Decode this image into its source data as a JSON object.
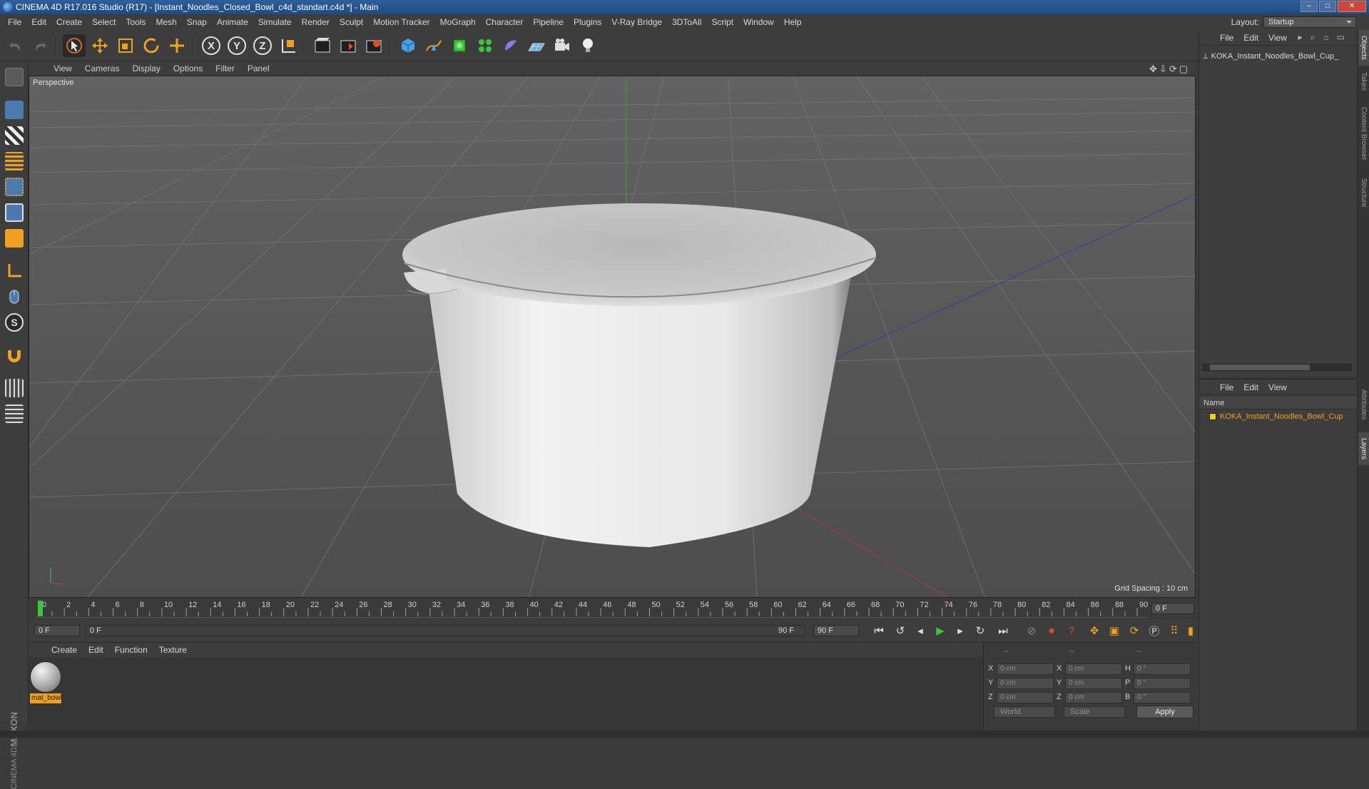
{
  "window": {
    "title": "CINEMA 4D R17.016 Studio (R17) - [Instant_Noodles_Closed_Bowl_c4d_standart.c4d *] - Main"
  },
  "menu": [
    "File",
    "Edit",
    "Create",
    "Select",
    "Tools",
    "Mesh",
    "Snap",
    "Animate",
    "Simulate",
    "Render",
    "Sculpt",
    "Motion Tracker",
    "MoGraph",
    "Character",
    "Pipeline",
    "Plugins",
    "V-Ray Bridge",
    "3DToAll",
    "Script",
    "Window",
    "Help"
  ],
  "layout": {
    "label": "Layout:",
    "value": "Startup"
  },
  "toolbar_icons": [
    "undo-icon",
    "redo-icon",
    "select-arrow-icon",
    "move-icon",
    "scale-icon",
    "rotate-icon",
    "transform-icon",
    "x-axis-icon",
    "y-axis-icon",
    "z-axis-icon",
    "coordinate-system-icon",
    "render-view-icon",
    "render-picture-viewer-icon",
    "render-settings-icon",
    "cube-primitive-icon",
    "pen-spline-icon",
    "subdivision-icon",
    "cloner-icon",
    "deformer-icon",
    "floor-icon",
    "camera-icon",
    "light-icon"
  ],
  "viewport": {
    "menu": [
      "View",
      "Cameras",
      "Display",
      "Options",
      "Filter",
      "Panel"
    ],
    "label": "Perspective",
    "grid_spacing": "Grid Spacing : 10 cm"
  },
  "timeline": {
    "ticks": [
      "0",
      "2",
      "4",
      "6",
      "8",
      "10",
      "12",
      "14",
      "16",
      "18",
      "20",
      "22",
      "24",
      "26",
      "28",
      "30",
      "32",
      "34",
      "36",
      "38",
      "40",
      "42",
      "44",
      "46",
      "48",
      "50",
      "52",
      "54",
      "56",
      "58",
      "60",
      "62",
      "64",
      "66",
      "68",
      "70",
      "72",
      "74",
      "76",
      "78",
      "80",
      "82",
      "84",
      "86",
      "88",
      "90"
    ],
    "current_frame": "0 F",
    "playhead_frame": 0
  },
  "transport": {
    "start": "0 F",
    "range_start": "0 F",
    "range_end": "90 F",
    "end": "90 F"
  },
  "material_panel": {
    "menu": [
      "Create",
      "Edit",
      "Function",
      "Texture"
    ],
    "material_name": "mat_bowl"
  },
  "coords": {
    "header": [
      "--",
      "--",
      "--"
    ],
    "rows": [
      {
        "a": "X",
        "av": "0 cm",
        "b": "X",
        "bv": "0 cm",
        "c": "H",
        "cv": "0 °"
      },
      {
        "a": "Y",
        "av": "0 cm",
        "b": "Y",
        "bv": "0 cm",
        "c": "P",
        "cv": "0 °"
      },
      {
        "a": "Z",
        "av": "0 cm",
        "b": "Z",
        "bv": "0 cm",
        "c": "B",
        "cv": "0 °"
      }
    ],
    "mode1": "World",
    "mode2": "Scale",
    "apply": "Apply"
  },
  "object_manager": {
    "menu": [
      "File",
      "Edit",
      "View"
    ],
    "object": "KOKA_Instant_Noodles_Bowl_Cup_"
  },
  "layer_manager": {
    "menu": [
      "File",
      "Edit",
      "View"
    ],
    "column": "Name",
    "layer": "KOKA_Instant_Noodles_Bowl_Cup"
  },
  "side_tabs": [
    "Objects",
    "Takes",
    "Content Browser",
    "Structure",
    "Attributes",
    "Layers"
  ],
  "brand": {
    "maxon": "MAXON",
    "product": "CINEMA 4D"
  },
  "colors": {
    "accent": "#f0a020",
    "layer_swatch": "#e8d020",
    "play": "#3ec43e"
  }
}
